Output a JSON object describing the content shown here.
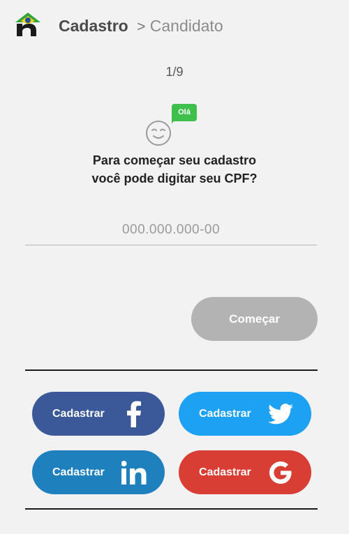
{
  "header": {
    "title": "Cadastro",
    "separator": ">",
    "subtitle": "Candidato"
  },
  "step": "1/9",
  "greeting_badge": "Olá",
  "question": {
    "line1": "Para começar seu cadastro",
    "line2": "você pode digitar seu CPF?"
  },
  "cpf": {
    "placeholder": "000.000.000-00",
    "value": ""
  },
  "start_button": "Começar",
  "social": [
    {
      "label": "Cadastrar",
      "icon": "facebook-icon",
      "color": "#3b5999"
    },
    {
      "label": "Cadastrar",
      "icon": "twitter-icon",
      "color": "#1da1f2"
    },
    {
      "label": "Cadastrar",
      "icon": "linkedin-icon",
      "color": "#1f80be"
    },
    {
      "label": "Cadastrar",
      "icon": "google-icon",
      "color": "#d83e34"
    }
  ],
  "colors": {
    "background": "#f2f2f2",
    "badge": "#3fbf4c",
    "disabled_button": "#b3b3b3"
  }
}
